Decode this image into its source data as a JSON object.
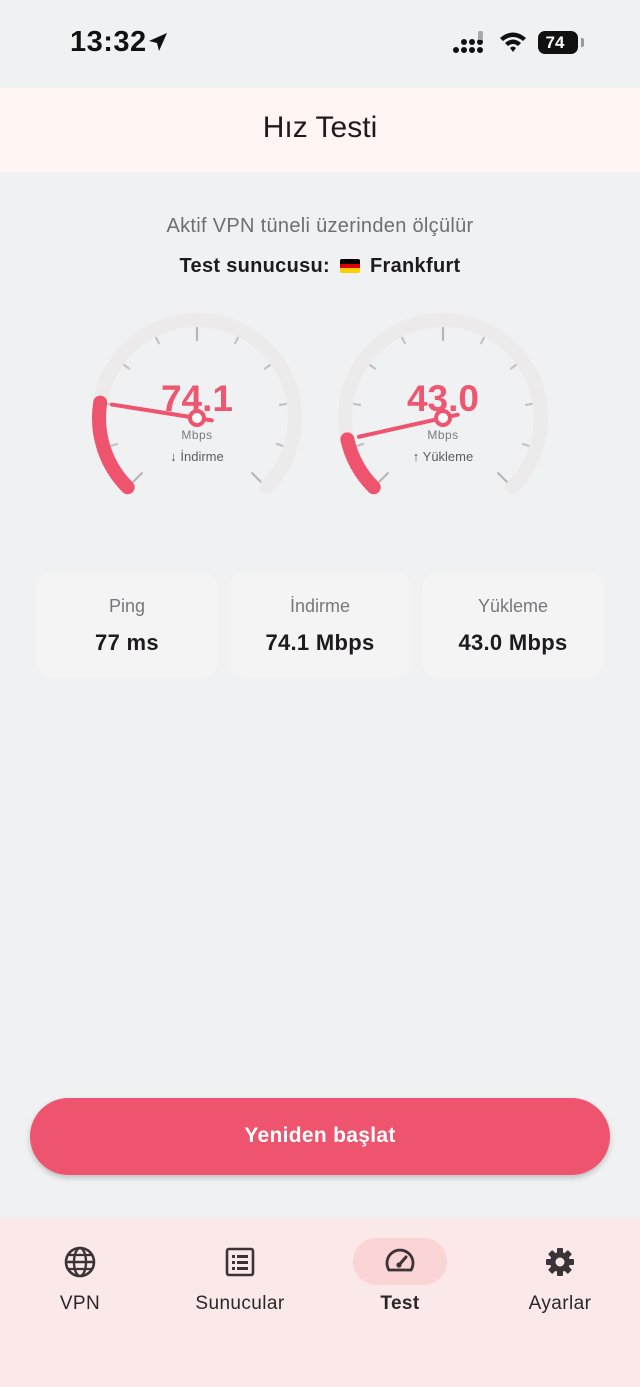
{
  "status_bar": {
    "time": "13:32",
    "battery": "74"
  },
  "app_bar": {
    "title": "Hız Testi"
  },
  "subtitle": "Aktif VPN tüneli üzerinden ölçülür",
  "server": {
    "label": "Test sunucusu:",
    "name": "Frankfurt",
    "flag_colors": [
      "#000000",
      "#dd0000",
      "#ffce00"
    ]
  },
  "gauges": [
    {
      "value": "74.1",
      "unit": "Mbps",
      "label": "↓ İndirme",
      "fill": 0.2
    },
    {
      "value": "43.0",
      "unit": "Mbps",
      "label": "↑ Yükleme",
      "fill": 0.12
    }
  ],
  "stats": [
    {
      "title": "Ping",
      "value": "77 ms"
    },
    {
      "title": "İndirme",
      "value": "74.1 Mbps"
    },
    {
      "title": "Yükleme",
      "value": "43.0 Mbps"
    }
  ],
  "restart_label": "Yeniden başlat",
  "nav": [
    {
      "label": "VPN",
      "icon": "globe-icon",
      "active": false
    },
    {
      "label": "Sunucular",
      "icon": "list-icon",
      "active": false
    },
    {
      "label": "Test",
      "icon": "speedometer-icon",
      "active": true
    },
    {
      "label": "Ayarlar",
      "icon": "gear-icon",
      "active": false
    }
  ],
  "colors": {
    "accent": "#ef546e",
    "track": "#eceaea",
    "nav_bg": "#fbe9e9",
    "active_pill": "#fbd4d6"
  }
}
